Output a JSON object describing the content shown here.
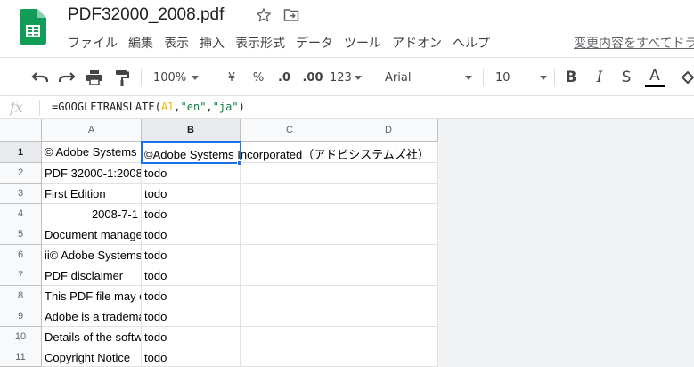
{
  "doc": {
    "title": "PDF32000_2008.pdf"
  },
  "menu": [
    "ファイル",
    "編集",
    "表示",
    "挿入",
    "表示形式",
    "データ",
    "ツール",
    "アドオン",
    "ヘルプ"
  ],
  "save_status": "変更内容をすべてドライブに保存しました",
  "toolbar": {
    "zoom": "100%",
    "currency": "¥",
    "percent": "%",
    "decimal_decrease": ".0",
    "decimal_increase": ".00",
    "more_formats": "123",
    "font": "Arial",
    "font_size": "10",
    "bold": "B",
    "italic": "I",
    "strike": "S",
    "text_color": "A"
  },
  "formula": {
    "fx": "fx",
    "fn": "=GOOGLETRANSLATE(",
    "ref": "A1",
    "sep1": ",",
    "str1": "\"en\"",
    "sep2": ",",
    "str2": "\"ja\"",
    "close": ")"
  },
  "columns": [
    "A",
    "B",
    "C",
    "D"
  ],
  "rows": [
    {
      "num": "1",
      "a": "© Adobe Systems Incorporated",
      "b": "©Adobe Systems Incorporated（アドビシステムズ社）"
    },
    {
      "num": "2",
      "a": "PDF 32000-1:2008",
      "b": "todo"
    },
    {
      "num": "3",
      "a": "First Edition",
      "b": "todo"
    },
    {
      "num": "4",
      "a": "2008-7-1",
      "b": "todo"
    },
    {
      "num": "5",
      "a": "Document management",
      "b": "todo"
    },
    {
      "num": "6",
      "a": "ii© Adobe Systems",
      "b": "todo"
    },
    {
      "num": "7",
      "a": "PDF disclaimer",
      "b": "todo"
    },
    {
      "num": "8",
      "a": "This PDF file may contain",
      "b": "todo"
    },
    {
      "num": "9",
      "a": "Adobe is a trademark",
      "b": "todo"
    },
    {
      "num": "10",
      "a": "Details of the software",
      "b": "todo"
    },
    {
      "num": "11",
      "a": "Copyright Notice",
      "b": "todo"
    }
  ],
  "colors": {
    "accent": "#1a73e8",
    "sheets_green": "#0f9d58"
  }
}
